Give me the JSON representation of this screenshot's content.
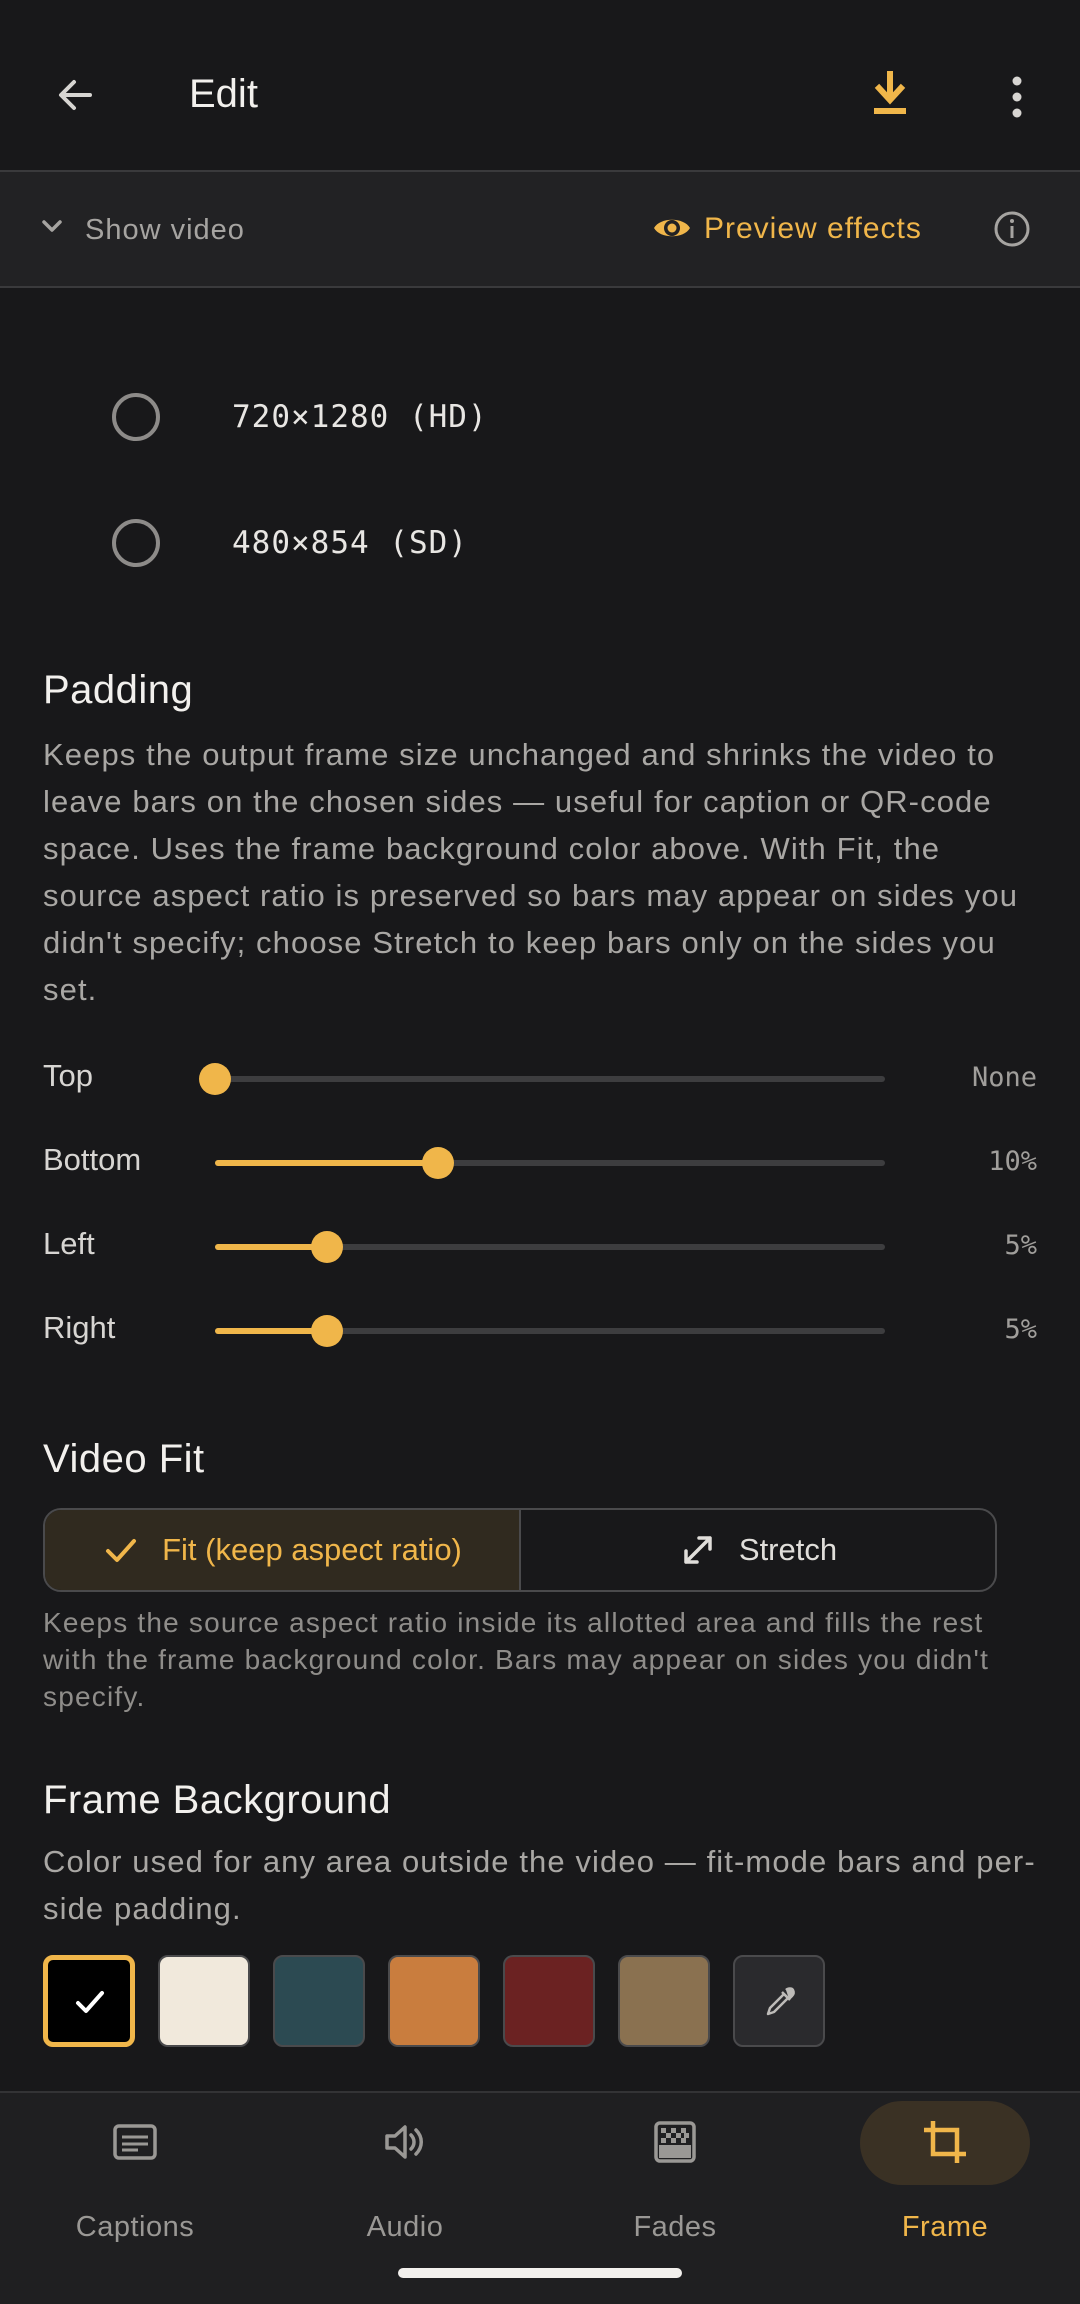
{
  "appbar": {
    "title": "Edit"
  },
  "videobar": {
    "show_label": "Show video",
    "preview_label": "Preview effects"
  },
  "resolutions": [
    {
      "label": "720×1280 (HD)"
    },
    {
      "label": "480×854 (SD)"
    }
  ],
  "padding": {
    "title": "Padding",
    "description": "Keeps the output frame size unchanged and shrinks the video to leave bars on the chosen sides — useful for caption or QR-code space. Uses the frame background color above. With Fit, the source aspect ratio is preserved so bars may appear on sides you didn't specify; choose Stretch to keep bars only on the sides you set.",
    "sliders": [
      {
        "label": "Top",
        "value_text": "None",
        "fraction": 0.0
      },
      {
        "label": "Bottom",
        "value_text": "10%",
        "fraction": 0.333
      },
      {
        "label": "Left",
        "value_text": "5%",
        "fraction": 0.167
      },
      {
        "label": "Right",
        "value_text": "5%",
        "fraction": 0.167
      }
    ]
  },
  "video_fit": {
    "title": "Video Fit",
    "options": [
      {
        "label": "Fit (keep aspect ratio)",
        "selected": true
      },
      {
        "label": "Stretch",
        "selected": false
      }
    ],
    "description": "Keeps the source aspect ratio inside its allotted area and fills the rest with the frame background color. Bars may appear on sides you didn't specify."
  },
  "frame_background": {
    "title": "Frame Background",
    "description": "Color used for any area outside the video — fit-mode bars and per-side padding.",
    "swatches": [
      "#000000",
      "#f1e9dc",
      "#2c4a52",
      "#c97d3e",
      "#6b2222",
      "#8a7150"
    ],
    "selected_index": 0
  },
  "bottom_nav": {
    "items": [
      {
        "label": "Captions",
        "icon": "captions-icon"
      },
      {
        "label": "Audio",
        "icon": "speaker-icon"
      },
      {
        "label": "Fades",
        "icon": "fades-icon"
      },
      {
        "label": "Frame",
        "icon": "crop-icon"
      }
    ],
    "active_index": 3
  },
  "colors": {
    "accent": "#f0b64a",
    "background": "#18181a"
  }
}
